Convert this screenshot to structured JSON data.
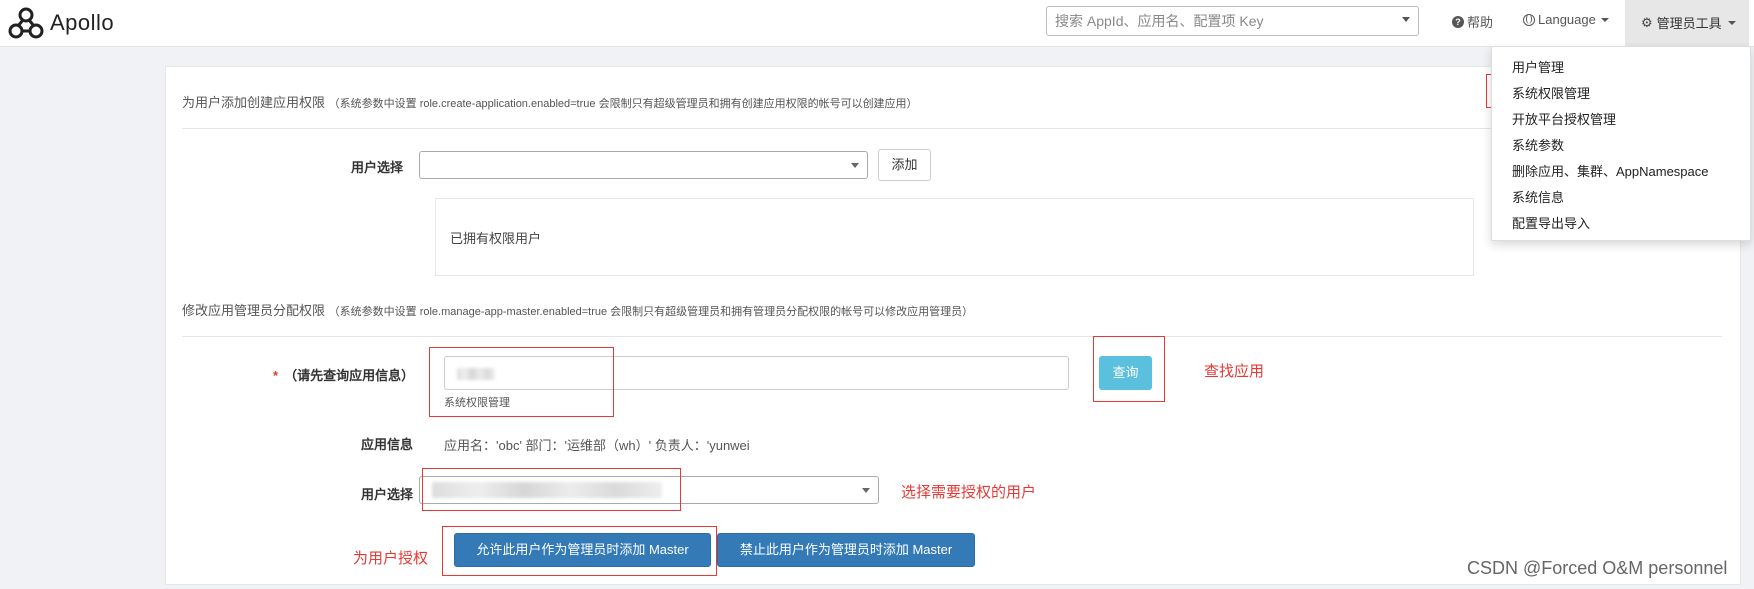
{
  "header": {
    "app_name": "Apollo",
    "search_placeholder": "搜索 AppId、应用名、配置项 Key",
    "help_label": "帮助",
    "language_label": "Language",
    "admin_tools_label": "管理员工具"
  },
  "admin_menu": {
    "items": [
      "用户管理",
      "系统权限管理",
      "开放平台授权管理",
      "系统参数",
      "删除应用、集群、AppNamespace",
      "系统信息",
      "配置导出导入"
    ]
  },
  "create_app_section": {
    "title": "为用户添加创建应用权限",
    "note": "（系统参数中设置 role.create-application.enabled=true 会限制只有超级管理员和拥有创建应用权限的帐号可以创建应用）",
    "user_select_label": "用户选择",
    "add_button": "添加",
    "owners_title": "已拥有权限用户"
  },
  "app_master_section": {
    "title": "修改应用管理员分配权限",
    "note": "（系统参数中设置 role.manage-app-master.enabled=true 会限制只有超级管理员和拥有管理员分配权限的帐号可以修改应用管理员）",
    "required_mark": "*",
    "app_query_label": "（请先查询应用信息）",
    "app_input_hint": "系统权限管理",
    "query_button": "查询",
    "app_info_label": "应用信息",
    "app_info_value": "应用名：'obc' 部门：'运维部（wh）' 负责人：'yunwei",
    "user_select_label": "用户选择",
    "allow_button": "允许此用户作为管理员时添加 Master",
    "deny_button": "禁止此用户作为管理员时添加 Master"
  },
  "annotations": {
    "find_app": "查找应用",
    "select_user": "选择需要授权的用户",
    "grant_user": "为用户授权"
  },
  "watermark": "CSDN @Forced O&M personnel",
  "colors": {
    "primary": "#337ab7",
    "info": "#5bc0de",
    "annotation_red": "#e53935"
  }
}
